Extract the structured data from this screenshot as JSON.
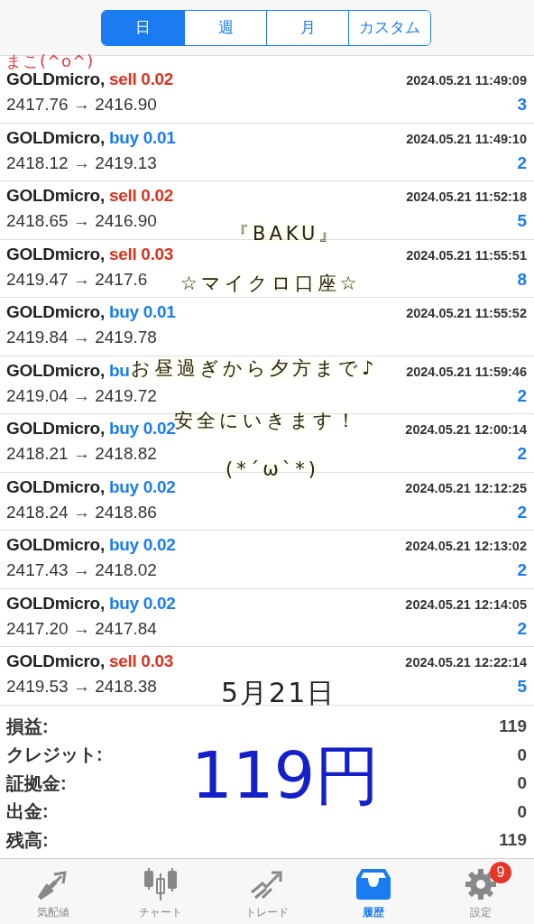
{
  "period_tabs": [
    {
      "label": "日",
      "selected": true
    },
    {
      "label": "週",
      "selected": false
    },
    {
      "label": "月",
      "selected": false
    },
    {
      "label": "カスタム",
      "selected": false
    }
  ],
  "deals": [
    {
      "symbol": "GOLDmicro,",
      "kind": "sell",
      "side": "sell",
      "lot": "0.02",
      "time": "2024.05.21 11:49:09",
      "open": "2417.76",
      "arrow": "→",
      "close": "2416.90",
      "profit": "3"
    },
    {
      "symbol": "GOLDmicro,",
      "kind": "buy",
      "side": "buy",
      "lot": "0.01",
      "time": "2024.05.21 11:49:10",
      "open": "2418.12",
      "arrow": "→",
      "close": "2419.13",
      "profit": "2"
    },
    {
      "symbol": "GOLDmicro,",
      "kind": "sell",
      "side": "sell",
      "lot": "0.02",
      "time": "2024.05.21 11:52:18",
      "open": "2418.65",
      "arrow": "→",
      "close": "2416.90",
      "profit": "5"
    },
    {
      "symbol": "GOLDmicro,",
      "kind": "sell",
      "side": "sell",
      "lot": "0.03",
      "time": "2024.05.21 11:55:51",
      "open": "2419.47",
      "arrow": "→",
      "close": "2417.6",
      "profit": "8"
    },
    {
      "symbol": "GOLDmicro,",
      "kind": "buy",
      "side": "buy",
      "lot": "0.01",
      "time": "2024.05.21 11:55:52",
      "open": "2419.84",
      "arrow": "→",
      "close": "2419.78"
    },
    {
      "symbol": "GOLDmicro,",
      "kind": "buy",
      "side": "bu",
      "time": "2024.05.21 11:59:46",
      "open": "2419.04",
      "arrow": "→",
      "close": "2419.72",
      "profit": "2"
    },
    {
      "symbol": "GOLDmicro,",
      "kind": "buy",
      "side": "buy",
      "lot": "0.02",
      "time": "2024.05.21 12:00:14",
      "open": "2418.21",
      "arrow": "→",
      "close": "2418.82",
      "profit": "2"
    },
    {
      "symbol": "GOLDmicro,",
      "kind": "buy",
      "side": "buy",
      "lot": "0.02",
      "time": "2024.05.21 12:12:25",
      "open": "2418.24",
      "arrow": "→",
      "close": "2418.86",
      "profit": "2"
    },
    {
      "symbol": "GOLDmicro,",
      "kind": "buy",
      "side": "buy",
      "lot": "0.02",
      "time": "2024.05.21 12:13:02",
      "open": "2417.43",
      "arrow": "→",
      "close": "2418.02",
      "profit": "2"
    },
    {
      "symbol": "GOLDmicro,",
      "kind": "buy",
      "side": "buy",
      "lot": "0.02",
      "time": "2024.05.21 12:14:05",
      "open": "2417.20",
      "arrow": "→",
      "close": "2417.84",
      "profit": "2"
    },
    {
      "symbol": "GOLDmicro,",
      "kind": "sell",
      "side": "sell",
      "lot": "0.03",
      "time": "2024.05.21 12:22:14",
      "open": "2419.53",
      "arrow": "→",
      "close": "2418.38",
      "profit": "5"
    }
  ],
  "summary": [
    {
      "label": "損益:",
      "value": "119"
    },
    {
      "label": "クレジット:",
      "value": "0"
    },
    {
      "label": "証拠金:",
      "value": "0"
    },
    {
      "label": "出金:",
      "value": "0"
    },
    {
      "label": "残高:",
      "value": "119"
    }
  ],
  "annotations": [
    {
      "kind": "red",
      "text": "まこ(^o^)"
    },
    {
      "kind": "note",
      "text": "『BAKU』"
    },
    {
      "kind": "note",
      "text": "☆マイクロ口座☆"
    },
    {
      "kind": "note",
      "text": "お昼過ぎから夕方まで♪"
    },
    {
      "kind": "note",
      "text": "安全にいきます！"
    },
    {
      "kind": "note",
      "text": "(*´ω`*)"
    },
    {
      "kind": "date",
      "text": "5月21日"
    },
    {
      "kind": "big",
      "text": "119円"
    }
  ],
  "tab_bar": [
    {
      "label": "気配値",
      "kind": "quotes",
      "selected": false
    },
    {
      "label": "チャート",
      "kind": "chart",
      "selected": false
    },
    {
      "label": "トレード",
      "kind": "trade",
      "selected": false
    },
    {
      "label": "履歴",
      "kind": "history",
      "selected": true
    },
    {
      "label": "設定",
      "kind": "settings",
      "selected": false,
      "badge": "9"
    }
  ]
}
